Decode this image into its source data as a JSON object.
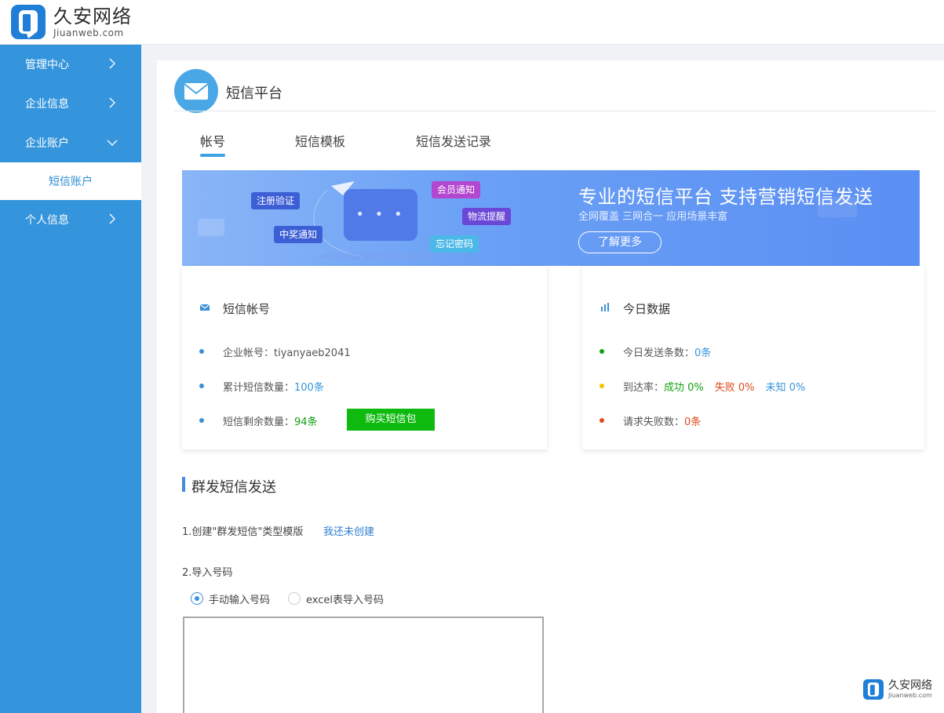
{
  "brand": {
    "name_cn": "久安网络",
    "domain": "Jiuanweb.com"
  },
  "sidebar": {
    "items": [
      {
        "label": "管理中心"
      },
      {
        "label": "企业信息"
      },
      {
        "label": "企业账户"
      },
      {
        "label": "个人信息"
      }
    ],
    "sub_items": [
      {
        "label": "短信账户"
      }
    ]
  },
  "page": {
    "title": "短信平台"
  },
  "tabs": [
    {
      "label": "帐号",
      "active": true
    },
    {
      "label": "短信模板"
    },
    {
      "label": "短信发送记录"
    }
  ],
  "banner": {
    "tags": [
      "注册验证",
      "会员通知",
      "物流提醒",
      "中奖通知",
      "忘记密码"
    ],
    "title": "专业的短信平台  支持营销短信发送",
    "subtitle": "全网覆盖    三网合一    应用场景丰富",
    "button": "了解更多"
  },
  "account_card": {
    "title": "短信帐号",
    "rows": [
      {
        "label": "企业帐号：",
        "value": "tiyanyaeb2041"
      },
      {
        "label": "累计短信数量：",
        "value": "100条"
      },
      {
        "label": "短信剩余数量：",
        "value": "94条"
      }
    ],
    "buy_button": "购买短信包"
  },
  "today_card": {
    "title": "今日数据",
    "sent_label": "今日发送条数：",
    "sent_value": "0条",
    "rate_label": "到达率：",
    "success": "成功 0%",
    "fail": "失败 0%",
    "unknown": "未知 0%",
    "failed_label": "请求失败数：",
    "failed_value": "0条"
  },
  "bulk": {
    "title": "群发短信发送",
    "step1": "1.创建\"群发短信\"类型模版",
    "step1_link": "我还未创建",
    "step2": "2.导入号码",
    "options": [
      {
        "label": "手动输入号码",
        "selected": true
      },
      {
        "label": "excel表导入号码",
        "selected": false
      }
    ]
  },
  "colors": {
    "sidebar": "#3595dc",
    "accent": "#3ba3e6",
    "buy": "#0dba0d",
    "success": "#12a012",
    "fail": "#e04a1c"
  }
}
